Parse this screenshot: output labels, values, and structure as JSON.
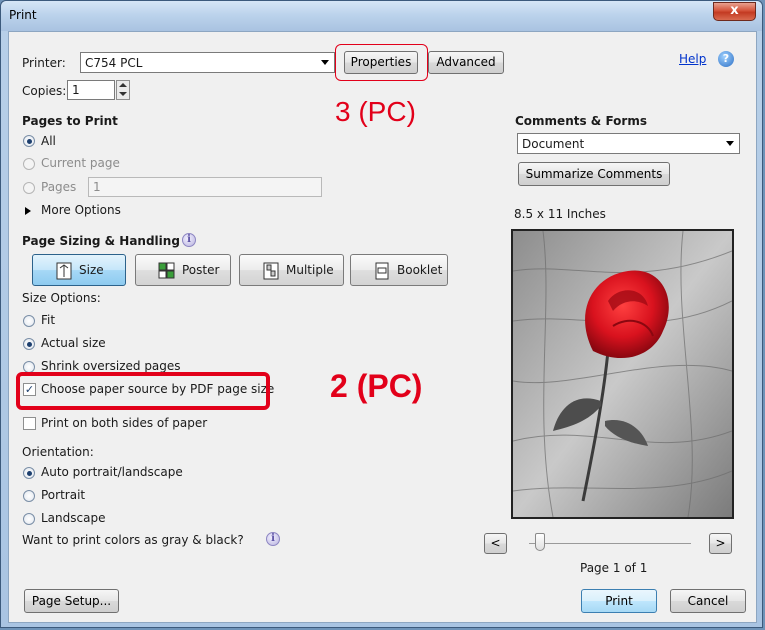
{
  "window": {
    "title": "Print",
    "close_glyph": "x"
  },
  "printer": {
    "label": "Printer:",
    "value": "C754 PCL",
    "properties_label": "Properties",
    "advanced_label": "Advanced",
    "help_label": "Help"
  },
  "copies": {
    "label": "Copies:",
    "value": "1"
  },
  "pages_to_print": {
    "heading": "Pages to Print",
    "all": "All",
    "current_page": "Current page",
    "pages": "Pages",
    "pages_value": "1",
    "more_options": "More Options"
  },
  "sizing": {
    "heading": "Page Sizing & Handling",
    "buttons": [
      "Size",
      "Poster",
      "Multiple",
      "Booklet"
    ],
    "size_options_label": "Size Options:",
    "fit": "Fit",
    "actual_size": "Actual size",
    "shrink": "Shrink oversized pages",
    "choose_paper": "Choose paper source by PDF page size",
    "both_sides": "Print on both sides of paper"
  },
  "orientation": {
    "label": "Orientation:",
    "auto": "Auto portrait/landscape",
    "portrait": "Portrait",
    "landscape": "Landscape"
  },
  "gray_question": "Want to print colors as gray & black?",
  "comments_forms": {
    "heading": "Comments & Forms",
    "value": "Document",
    "summarize_label": "Summarize Comments"
  },
  "preview": {
    "paper_size": "8.5 x 11 Inches",
    "prev_label": "<",
    "next_label": ">",
    "page_status": "Page 1 of 1"
  },
  "annotations": {
    "callout_3": "3 (PC)",
    "callout_2": "2 (PC)"
  },
  "footer": {
    "page_setup_label": "Page Setup...",
    "print_label": "Print",
    "cancel_label": "Cancel"
  },
  "colors": {
    "accent_red": "#e2001a",
    "link_blue": "#0033cc"
  }
}
